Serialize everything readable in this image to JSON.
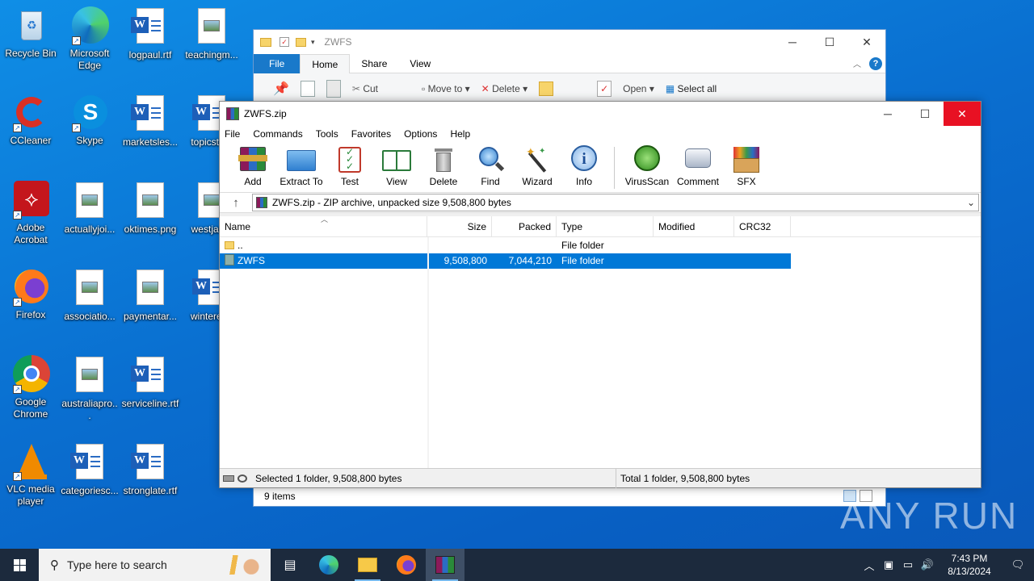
{
  "desktop": {
    "icons": [
      {
        "label": "Recycle Bin"
      },
      {
        "label": "Microsoft Edge"
      },
      {
        "label": "logpaul.rtf"
      },
      {
        "label": "teachingm..."
      },
      {
        "label": "CCleaner"
      },
      {
        "label": "Skype"
      },
      {
        "label": "marketsles..."
      },
      {
        "label": "topicste..."
      },
      {
        "label": "Adobe Acrobat"
      },
      {
        "label": "actuallyjoi..."
      },
      {
        "label": "oktimes.png"
      },
      {
        "label": "westjan..."
      },
      {
        "label": "Firefox"
      },
      {
        "label": "associatio..."
      },
      {
        "label": "paymentar..."
      },
      {
        "label": "winterer..."
      },
      {
        "label": "Google Chrome"
      },
      {
        "label": "australiapro..."
      },
      {
        "label": "serviceline.rtf"
      },
      {
        "label": "VLC media player"
      },
      {
        "label": "categoriesc..."
      },
      {
        "label": "stronglate.rtf"
      }
    ]
  },
  "explorer": {
    "title": "ZWFS",
    "tabs": [
      "File",
      "Home",
      "Share",
      "View"
    ],
    "ribbon": {
      "cut": "Cut",
      "move_to": "Move to",
      "delete": "Delete",
      "open": "Open",
      "select_all": "Select all"
    },
    "status": "9 items"
  },
  "winrar": {
    "title": "ZWFS.zip",
    "menu": [
      "File",
      "Commands",
      "Tools",
      "Favorites",
      "Options",
      "Help"
    ],
    "toolbar": [
      "Add",
      "Extract To",
      "Test",
      "View",
      "Delete",
      "Find",
      "Wizard",
      "Info",
      "VirusScan",
      "Comment",
      "SFX"
    ],
    "address": "ZWFS.zip - ZIP archive, unpacked size 9,508,800 bytes",
    "columns": [
      "Name",
      "Size",
      "Packed",
      "Type",
      "Modified",
      "CRC32"
    ],
    "rows": [
      {
        "name": "..",
        "size": "",
        "packed": "",
        "type": "File folder",
        "modified": "",
        "crc": ""
      },
      {
        "name": "ZWFS",
        "size": "9,508,800",
        "packed": "7,044,210",
        "type": "File folder",
        "modified": "",
        "crc": ""
      }
    ],
    "status_left": "Selected 1 folder, 9,508,800 bytes",
    "status_right": "Total 1 folder, 9,508,800 bytes"
  },
  "taskbar": {
    "search_placeholder": "Type here to search",
    "time": "7:43 PM",
    "date": "8/13/2024"
  },
  "watermark": "ANY RUN"
}
